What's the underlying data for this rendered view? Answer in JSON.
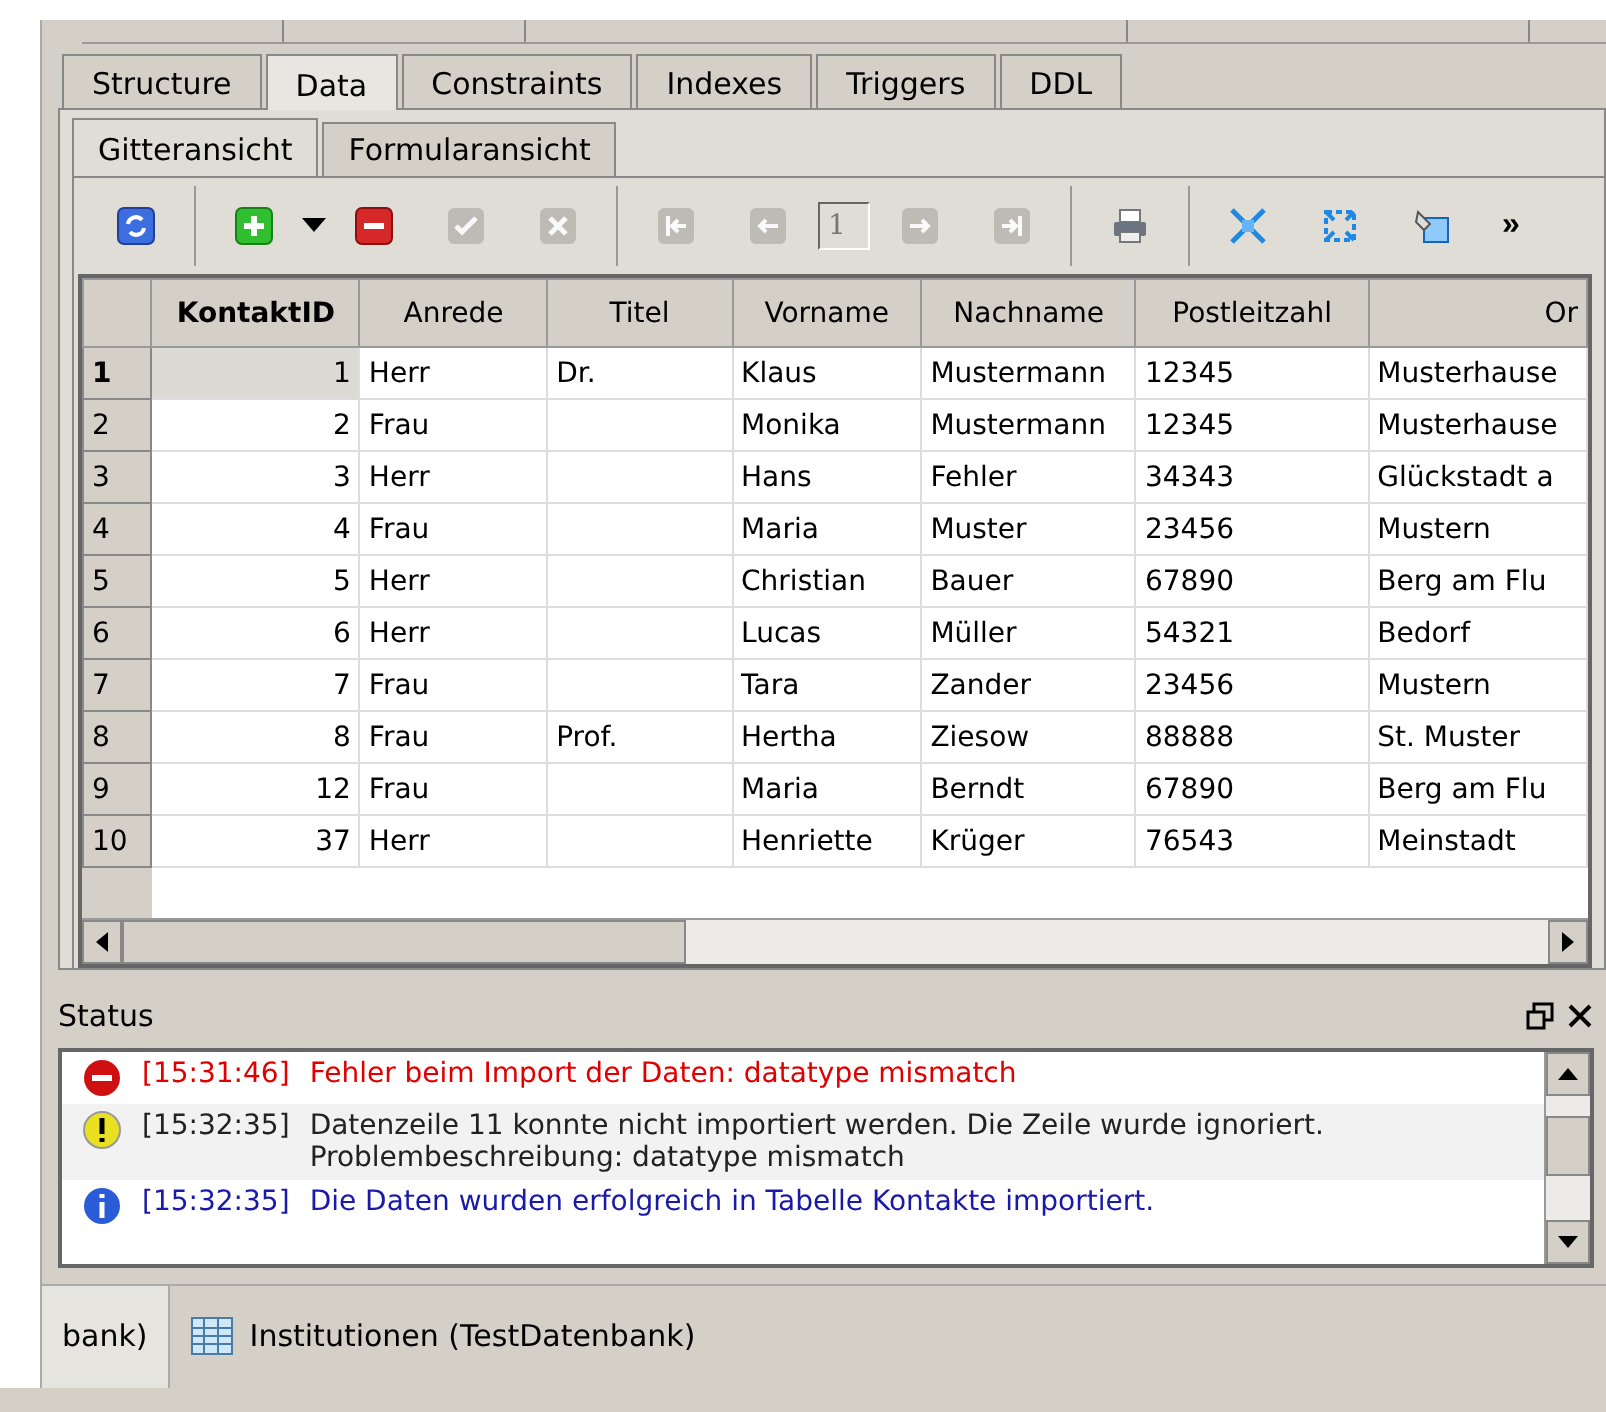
{
  "tabs": [
    {
      "label": "Structure",
      "selected": false
    },
    {
      "label": "Data",
      "selected": true
    },
    {
      "label": "Constraints",
      "selected": false
    },
    {
      "label": "Indexes",
      "selected": false
    },
    {
      "label": "Triggers",
      "selected": false
    },
    {
      "label": "DDL",
      "selected": false
    }
  ],
  "subtabs": [
    {
      "label": "Gitteransicht",
      "selected": true
    },
    {
      "label": "Formularansicht",
      "selected": false
    }
  ],
  "toolbar": [
    {
      "kind": "button",
      "disabled": false
    },
    {
      "kind": "separator"
    },
    {
      "kind": "button",
      "disabled": false
    },
    {
      "kind": "dropdown",
      "disabled": false
    },
    {
      "kind": "button",
      "disabled": false
    },
    {
      "kind": "button",
      "disabled": true
    },
    {
      "kind": "button",
      "disabled": true
    },
    {
      "kind": "separator"
    },
    {
      "kind": "button",
      "disabled": true
    },
    {
      "kind": "button",
      "disabled": true
    },
    {
      "kind": "field",
      "value": "1"
    },
    {
      "kind": "button",
      "disabled": true
    },
    {
      "kind": "button",
      "disabled": true
    },
    {
      "kind": "separator"
    },
    {
      "kind": "button",
      "disabled": false
    },
    {
      "kind": "separator"
    },
    {
      "kind": "button",
      "disabled": false
    },
    {
      "kind": "button",
      "disabled": false
    },
    {
      "kind": "button",
      "disabled": false
    },
    {
      "kind": "overflow",
      "label": "»"
    }
  ],
  "table": {
    "columns": [
      "KontaktID",
      "Anrede",
      "Titel",
      "Vorname",
      "Nachname",
      "Postleitzahl",
      "Or"
    ],
    "rows": [
      {
        "number": "1",
        "selected": true,
        "cells": [
          "1",
          "Herr",
          "Dr.",
          "Klaus",
          "Mustermann",
          "12345",
          "Musterhause"
        ]
      },
      {
        "number": "2",
        "selected": false,
        "cells": [
          "2",
          "Frau",
          null,
          "Monika",
          "Mustermann",
          "12345",
          "Musterhause"
        ]
      },
      {
        "number": "3",
        "selected": false,
        "cells": [
          "3",
          "Herr",
          null,
          "Hans",
          "Fehler",
          "34343",
          "Glückstadt a"
        ]
      },
      {
        "number": "4",
        "selected": false,
        "cells": [
          "4",
          "Frau",
          null,
          "Maria",
          "Muster",
          "23456",
          "Mustern"
        ]
      },
      {
        "number": "5",
        "selected": false,
        "cells": [
          "5",
          "Herr",
          null,
          "Christian",
          "Bauer",
          "67890",
          "Berg am Flu"
        ]
      },
      {
        "number": "6",
        "selected": false,
        "cells": [
          "6",
          "Herr",
          null,
          "Lucas",
          "Müller",
          "54321",
          "Bedorf"
        ]
      },
      {
        "number": "7",
        "selected": false,
        "cells": [
          "7",
          "Frau",
          null,
          "Tara",
          "Zander",
          "23456",
          "Mustern"
        ]
      },
      {
        "number": "8",
        "selected": false,
        "cells": [
          "8",
          "Frau",
          "Prof.",
          "Hertha",
          "Ziesow",
          "88888",
          "St. Muster"
        ]
      },
      {
        "number": "9",
        "selected": false,
        "cells": [
          "12",
          "Frau",
          null,
          "Maria",
          "Berndt",
          "67890",
          "Berg am Flu"
        ]
      },
      {
        "number": "10",
        "selected": false,
        "cells": [
          "37",
          "Herr",
          null,
          "Henriette",
          "Krüger",
          "76543",
          "Meinstadt"
        ]
      }
    ]
  },
  "status": {
    "title": "Status",
    "messages": [
      {
        "kind": "error",
        "time": "[15:31:46]",
        "text": "Fehler beim Import der Daten: datatype mismatch"
      },
      {
        "kind": "warning",
        "time": "[15:32:35]",
        "text": "Datenzeile 11 konnte nicht importiert werden. Die Zeile wurde ignoriert.\nProblembeschreibung: datatype mismatch"
      },
      {
        "kind": "info",
        "time": "[15:32:35]",
        "text": "Die Daten wurden erfolgreich in Tabelle Kontakte  importiert."
      }
    ]
  },
  "taskbar": [
    {
      "label": "bank)",
      "selected": true
    },
    {
      "label": "Institutionen (TestDatenbank)",
      "selected": false
    }
  ]
}
